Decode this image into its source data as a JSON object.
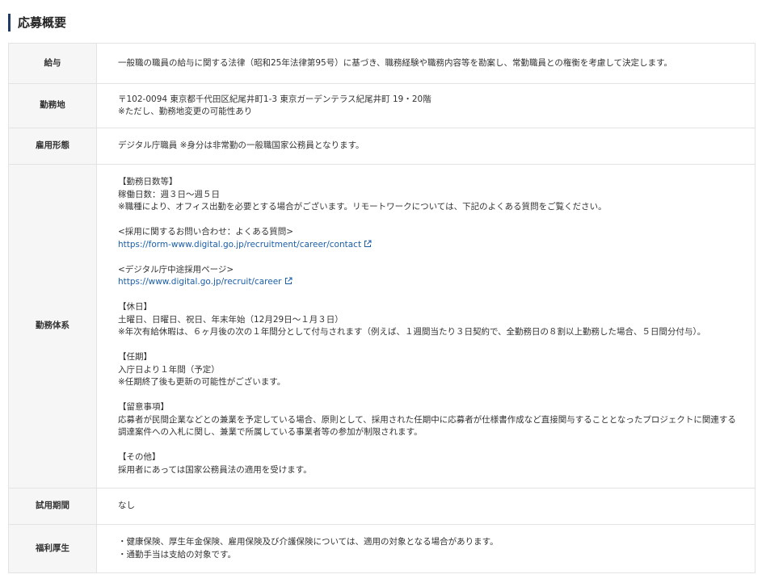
{
  "section": {
    "title": "応募概要"
  },
  "rows": {
    "salary": {
      "label": "給与",
      "text": "一般職の職員の給与に関する法律（昭和25年法律第95号）に基づき、職務経験や職務内容等を勘案し、常勤職員との権衡を考慮して決定します。"
    },
    "location": {
      "label": "勤務地",
      "line1": "〒102-0094 東京都千代田区紀尾井町1-3 東京ガーデンテラス紀尾井町 19・20階",
      "line2": "※ただし、勤務地変更の可能性あり"
    },
    "employment": {
      "label": "雇用形態",
      "text": "デジタル庁職員 ※身分は非常勤の一般職国家公務員となります。"
    },
    "work": {
      "label": "勤務体系",
      "days_heading": "【勤務日数等】",
      "days_text": "稼働日数：週３日～週５日",
      "days_note": "※職種により、オフィス出勤を必要とする場合がございます。リモートワークについては、下記のよくある質問をご覧ください。",
      "faq_heading": "<採用に関するお問い合わせ：よくある質問>",
      "faq_link": "https://form-www.digital.go.jp/recruitment/career/contact",
      "recruit_heading": "<デジタル庁中途採用ページ>",
      "recruit_link": "https://www.digital.go.jp/recruit/career",
      "holiday_heading": "【休日】",
      "holiday_text": "土曜日、日曜日、祝日、年末年始（12月29日～１月３日）",
      "holiday_note": "※年次有給休暇は、６ヶ月後の次の１年間分として付与されます（例えば、１週間当たり３日契約で、全勤務日の８割以上勤務した場合、５日間分付与）。",
      "term_heading": "【任期】",
      "term_text": "入庁日より１年間（予定）",
      "term_note": "※任期終了後も更新の可能性がございます。",
      "notice_heading": "【留意事項】",
      "notice_text": "応募者が民間企業などとの兼業を予定している場合、原則として、採用された任期中に応募者が仕様書作成など直接関与することとなったプロジェクトに関連する調達案件への入札に関し、兼業で所属している事業者等の参加が制限されます。",
      "other_heading": "【その他】",
      "other_text": "採用者にあっては国家公務員法の適用を受けます。"
    },
    "probation": {
      "label": "試用期間",
      "text": "なし"
    },
    "welfare": {
      "label": "福利厚生",
      "line1": "・健康保険、厚生年金保険、雇用保険及び介護保険については、適用の対象となる場合があります。",
      "line2": "・通勤手当は支給の対象です。"
    }
  },
  "colors": {
    "heading_accent": "#1f3b66",
    "link": "#1b5fa8",
    "label_bg": "#f6f6f6",
    "border": "#e3e3e3"
  },
  "icons": {
    "external_link": "external-link-icon"
  }
}
